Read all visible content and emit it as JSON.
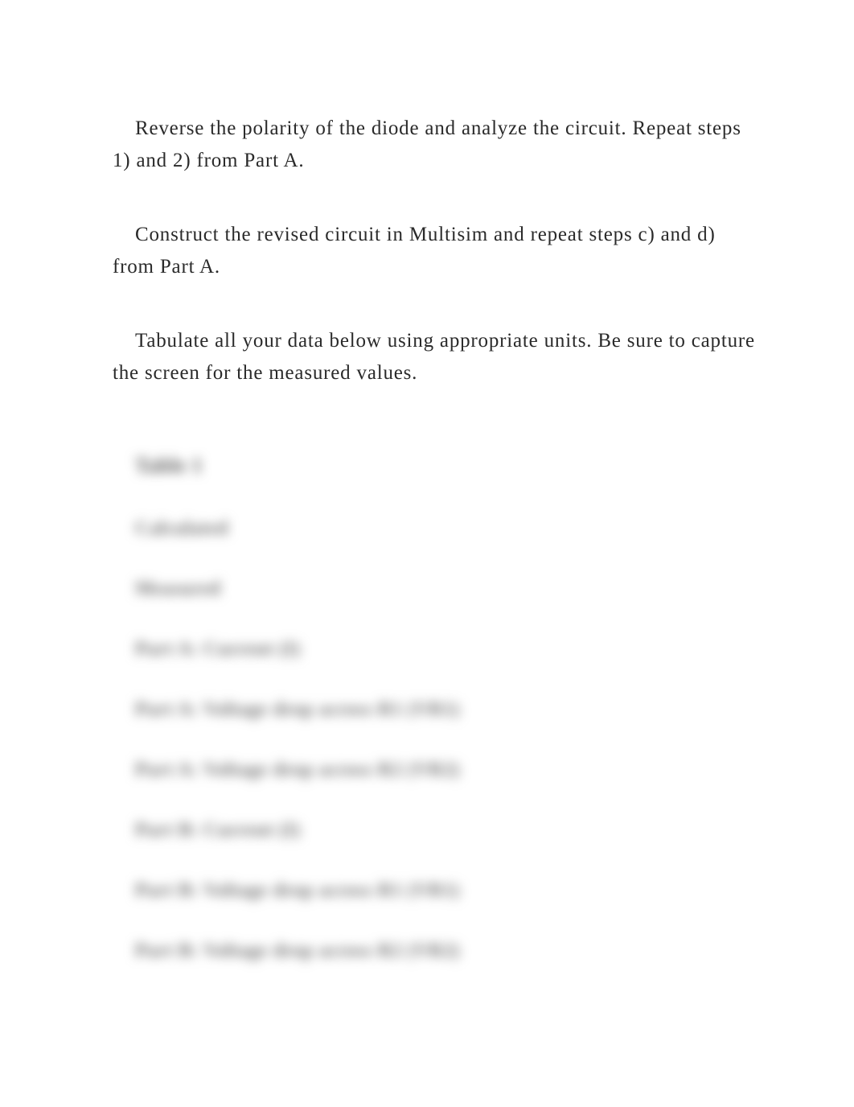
{
  "paragraphs": {
    "p1": "Reverse the polarity of the diode and analyze the circuit. Repeat steps 1) and 2) from Part A.",
    "p2": "Construct the revised circuit in Multisim and repeat steps c) and d) from Part A.",
    "p3": "Tabulate all your data below using appropriate units. Be sure to capture the screen for the measured values."
  },
  "blurred": {
    "title": "Table 1",
    "rows": [
      "Calculated",
      "Measured",
      "Part A: Current (I)",
      "Part A: Voltage drop across R1 (VR1)",
      "Part A: Voltage drop across R2 (VR2)",
      "Part B: Current (I)",
      "Part B: Voltage drop across R1 (VR1)",
      "Part B: Voltage drop across R2 (VR2)"
    ]
  }
}
